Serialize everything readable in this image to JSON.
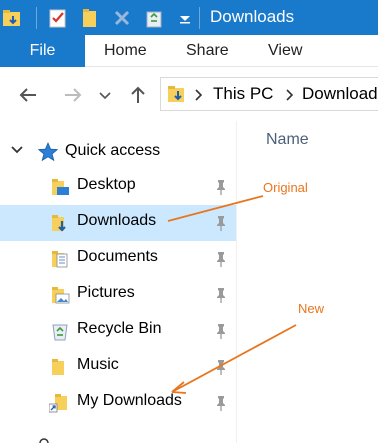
{
  "window": {
    "title": "Downloads"
  },
  "ribbon": {
    "file": "File",
    "tabs": [
      "Home",
      "Share",
      "View"
    ]
  },
  "address": {
    "crumbs": [
      "This PC",
      "Downloads"
    ]
  },
  "content": {
    "column_header": "Name"
  },
  "nav": {
    "quick_access": "Quick access",
    "items": [
      {
        "label": "Desktop",
        "icon": "desktop-folder"
      },
      {
        "label": "Downloads",
        "icon": "downloads-folder",
        "selected": true
      },
      {
        "label": "Documents",
        "icon": "documents-folder"
      },
      {
        "label": "Pictures",
        "icon": "pictures-folder"
      },
      {
        "label": "Recycle Bin",
        "icon": "recycle-bin"
      },
      {
        "label": "Music",
        "icon": "music-folder"
      },
      {
        "label": "My Downloads",
        "icon": "shortcut-folder"
      }
    ]
  },
  "annotations": {
    "original": "Original",
    "new": "New"
  },
  "colors": {
    "accent": "#1979ca",
    "selection": "#cce8ff",
    "annotation": "#e8761e"
  }
}
